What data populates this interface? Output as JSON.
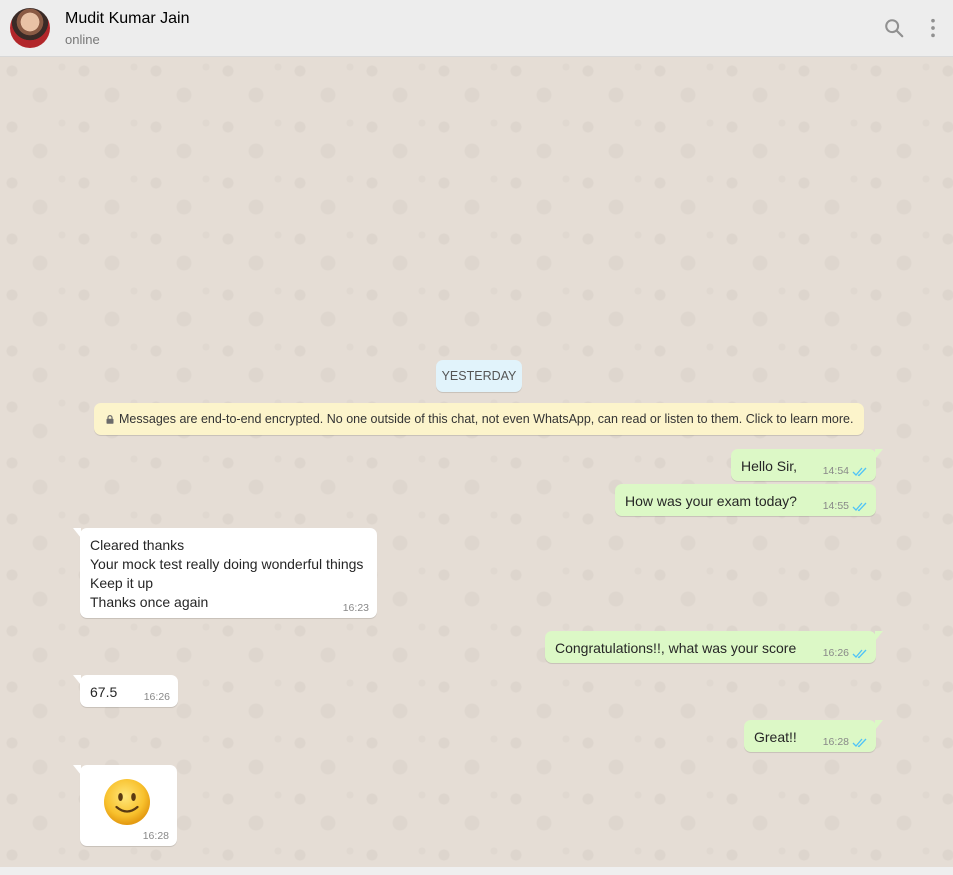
{
  "header": {
    "contact_name": "Mudit Kumar Jain",
    "status": "online",
    "icons": [
      "search-icon",
      "menu-dots-icon"
    ]
  },
  "chat": {
    "date_separator": "YESTERDAY",
    "encryption_notice": "Messages are end-to-end encrypted. No one outside of this chat, not even WhatsApp, can read or listen to them. Click to learn more.",
    "messages": [
      {
        "direction": "outgoing",
        "text": "Hello Sir,",
        "time": "14:54",
        "status": "read"
      },
      {
        "direction": "outgoing",
        "text": "How was your exam today?",
        "time": "14:55",
        "status": "read"
      },
      {
        "direction": "incoming",
        "text": "Cleared thanks\nYour mock test really doing wonderful things\nKeep it up\nThanks once again",
        "time": "16:23"
      },
      {
        "direction": "outgoing",
        "text": "Congratulations!!, what was your score",
        "time": "16:26",
        "status": "read"
      },
      {
        "direction": "incoming",
        "text": "67.5",
        "time": "16:26"
      },
      {
        "direction": "outgoing",
        "text": "Great!!",
        "time": "16:28",
        "status": "read"
      },
      {
        "direction": "incoming",
        "emoji": "slightly-smiling-face",
        "time": "16:28"
      }
    ]
  },
  "colors": {
    "header_bg": "#ededed",
    "chat_bg": "#e5ddd5",
    "incoming_bubble": "#ffffff",
    "outgoing_bubble": "#dcf8c6",
    "date_chip": "#e1f3fb",
    "e2e_notice": "#fcf4cb",
    "read_ticks": "#4fc3f7"
  }
}
